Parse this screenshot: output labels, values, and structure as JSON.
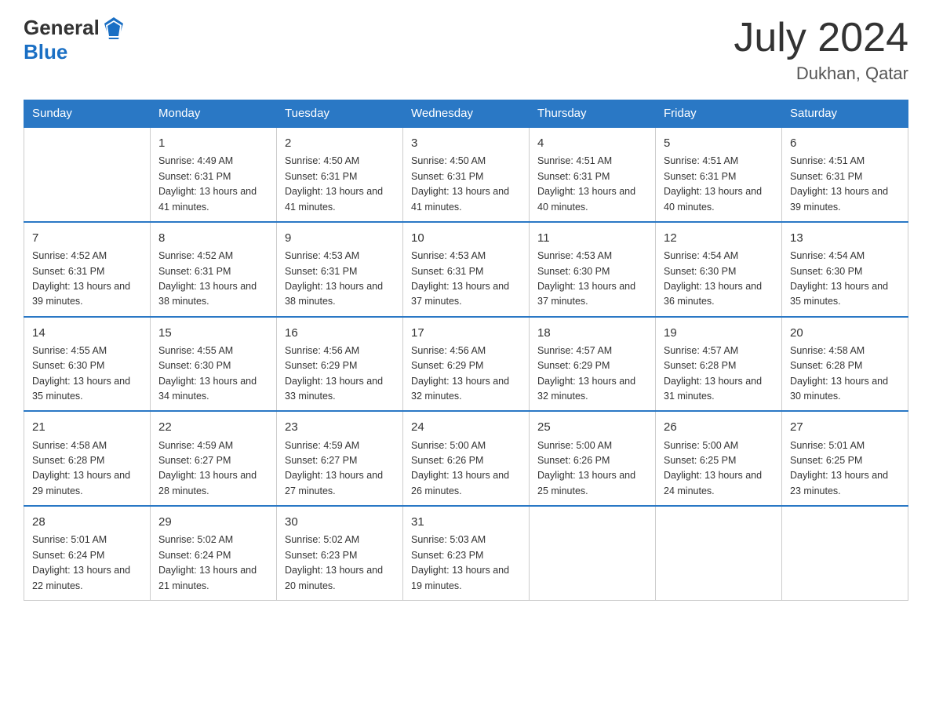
{
  "header": {
    "logo_general": "General",
    "logo_blue": "Blue",
    "month_year": "July 2024",
    "location": "Dukhan, Qatar"
  },
  "days_of_week": [
    "Sunday",
    "Monday",
    "Tuesday",
    "Wednesday",
    "Thursday",
    "Friday",
    "Saturday"
  ],
  "weeks": [
    [
      {
        "day": "",
        "sunrise": "",
        "sunset": "",
        "daylight": ""
      },
      {
        "day": "1",
        "sunrise": "Sunrise: 4:49 AM",
        "sunset": "Sunset: 6:31 PM",
        "daylight": "Daylight: 13 hours and 41 minutes."
      },
      {
        "day": "2",
        "sunrise": "Sunrise: 4:50 AM",
        "sunset": "Sunset: 6:31 PM",
        "daylight": "Daylight: 13 hours and 41 minutes."
      },
      {
        "day": "3",
        "sunrise": "Sunrise: 4:50 AM",
        "sunset": "Sunset: 6:31 PM",
        "daylight": "Daylight: 13 hours and 41 minutes."
      },
      {
        "day": "4",
        "sunrise": "Sunrise: 4:51 AM",
        "sunset": "Sunset: 6:31 PM",
        "daylight": "Daylight: 13 hours and 40 minutes."
      },
      {
        "day": "5",
        "sunrise": "Sunrise: 4:51 AM",
        "sunset": "Sunset: 6:31 PM",
        "daylight": "Daylight: 13 hours and 40 minutes."
      },
      {
        "day": "6",
        "sunrise": "Sunrise: 4:51 AM",
        "sunset": "Sunset: 6:31 PM",
        "daylight": "Daylight: 13 hours and 39 minutes."
      }
    ],
    [
      {
        "day": "7",
        "sunrise": "Sunrise: 4:52 AM",
        "sunset": "Sunset: 6:31 PM",
        "daylight": "Daylight: 13 hours and 39 minutes."
      },
      {
        "day": "8",
        "sunrise": "Sunrise: 4:52 AM",
        "sunset": "Sunset: 6:31 PM",
        "daylight": "Daylight: 13 hours and 38 minutes."
      },
      {
        "day": "9",
        "sunrise": "Sunrise: 4:53 AM",
        "sunset": "Sunset: 6:31 PM",
        "daylight": "Daylight: 13 hours and 38 minutes."
      },
      {
        "day": "10",
        "sunrise": "Sunrise: 4:53 AM",
        "sunset": "Sunset: 6:31 PM",
        "daylight": "Daylight: 13 hours and 37 minutes."
      },
      {
        "day": "11",
        "sunrise": "Sunrise: 4:53 AM",
        "sunset": "Sunset: 6:30 PM",
        "daylight": "Daylight: 13 hours and 37 minutes."
      },
      {
        "day": "12",
        "sunrise": "Sunrise: 4:54 AM",
        "sunset": "Sunset: 6:30 PM",
        "daylight": "Daylight: 13 hours and 36 minutes."
      },
      {
        "day": "13",
        "sunrise": "Sunrise: 4:54 AM",
        "sunset": "Sunset: 6:30 PM",
        "daylight": "Daylight: 13 hours and 35 minutes."
      }
    ],
    [
      {
        "day": "14",
        "sunrise": "Sunrise: 4:55 AM",
        "sunset": "Sunset: 6:30 PM",
        "daylight": "Daylight: 13 hours and 35 minutes."
      },
      {
        "day": "15",
        "sunrise": "Sunrise: 4:55 AM",
        "sunset": "Sunset: 6:30 PM",
        "daylight": "Daylight: 13 hours and 34 minutes."
      },
      {
        "day": "16",
        "sunrise": "Sunrise: 4:56 AM",
        "sunset": "Sunset: 6:29 PM",
        "daylight": "Daylight: 13 hours and 33 minutes."
      },
      {
        "day": "17",
        "sunrise": "Sunrise: 4:56 AM",
        "sunset": "Sunset: 6:29 PM",
        "daylight": "Daylight: 13 hours and 32 minutes."
      },
      {
        "day": "18",
        "sunrise": "Sunrise: 4:57 AM",
        "sunset": "Sunset: 6:29 PM",
        "daylight": "Daylight: 13 hours and 32 minutes."
      },
      {
        "day": "19",
        "sunrise": "Sunrise: 4:57 AM",
        "sunset": "Sunset: 6:28 PM",
        "daylight": "Daylight: 13 hours and 31 minutes."
      },
      {
        "day": "20",
        "sunrise": "Sunrise: 4:58 AM",
        "sunset": "Sunset: 6:28 PM",
        "daylight": "Daylight: 13 hours and 30 minutes."
      }
    ],
    [
      {
        "day": "21",
        "sunrise": "Sunrise: 4:58 AM",
        "sunset": "Sunset: 6:28 PM",
        "daylight": "Daylight: 13 hours and 29 minutes."
      },
      {
        "day": "22",
        "sunrise": "Sunrise: 4:59 AM",
        "sunset": "Sunset: 6:27 PM",
        "daylight": "Daylight: 13 hours and 28 minutes."
      },
      {
        "day": "23",
        "sunrise": "Sunrise: 4:59 AM",
        "sunset": "Sunset: 6:27 PM",
        "daylight": "Daylight: 13 hours and 27 minutes."
      },
      {
        "day": "24",
        "sunrise": "Sunrise: 5:00 AM",
        "sunset": "Sunset: 6:26 PM",
        "daylight": "Daylight: 13 hours and 26 minutes."
      },
      {
        "day": "25",
        "sunrise": "Sunrise: 5:00 AM",
        "sunset": "Sunset: 6:26 PM",
        "daylight": "Daylight: 13 hours and 25 minutes."
      },
      {
        "day": "26",
        "sunrise": "Sunrise: 5:00 AM",
        "sunset": "Sunset: 6:25 PM",
        "daylight": "Daylight: 13 hours and 24 minutes."
      },
      {
        "day": "27",
        "sunrise": "Sunrise: 5:01 AM",
        "sunset": "Sunset: 6:25 PM",
        "daylight": "Daylight: 13 hours and 23 minutes."
      }
    ],
    [
      {
        "day": "28",
        "sunrise": "Sunrise: 5:01 AM",
        "sunset": "Sunset: 6:24 PM",
        "daylight": "Daylight: 13 hours and 22 minutes."
      },
      {
        "day": "29",
        "sunrise": "Sunrise: 5:02 AM",
        "sunset": "Sunset: 6:24 PM",
        "daylight": "Daylight: 13 hours and 21 minutes."
      },
      {
        "day": "30",
        "sunrise": "Sunrise: 5:02 AM",
        "sunset": "Sunset: 6:23 PM",
        "daylight": "Daylight: 13 hours and 20 minutes."
      },
      {
        "day": "31",
        "sunrise": "Sunrise: 5:03 AM",
        "sunset": "Sunset: 6:23 PM",
        "daylight": "Daylight: 13 hours and 19 minutes."
      },
      {
        "day": "",
        "sunrise": "",
        "sunset": "",
        "daylight": ""
      },
      {
        "day": "",
        "sunrise": "",
        "sunset": "",
        "daylight": ""
      },
      {
        "day": "",
        "sunrise": "",
        "sunset": "",
        "daylight": ""
      }
    ]
  ]
}
